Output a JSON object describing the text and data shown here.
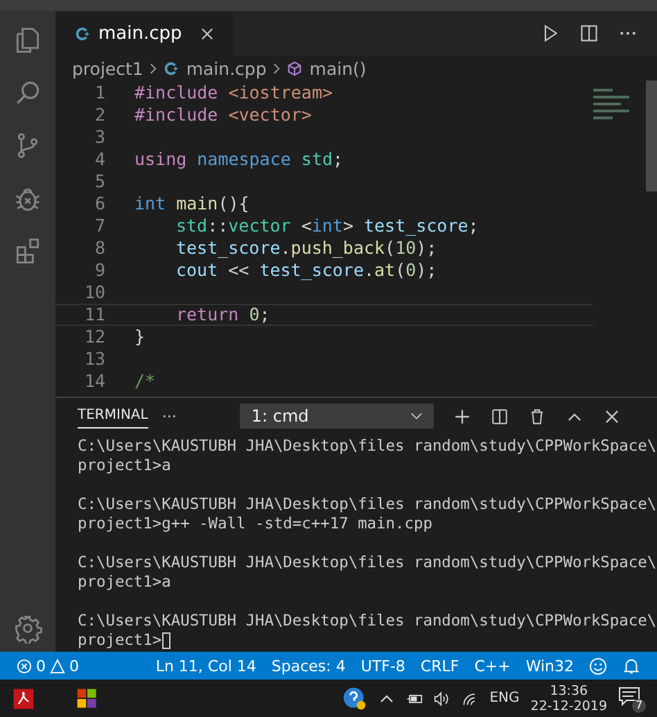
{
  "tabs": [
    {
      "label": "main.cpp",
      "selected": true
    }
  ],
  "breadcrumb": [
    "project1",
    "main.cpp",
    "main()"
  ],
  "code_lines": [
    {
      "number": "1",
      "tokens": [
        {
          "kind": "dir",
          "text": "#include "
        },
        {
          "kind": "str",
          "text": "<iostream>"
        }
      ]
    },
    {
      "number": "2",
      "tokens": [
        {
          "kind": "dir",
          "text": "#include "
        },
        {
          "kind": "str",
          "text": "<vector>"
        }
      ]
    },
    {
      "number": "3"
    },
    {
      "number": "4",
      "tokens": [
        {
          "kind": "kw",
          "text": "using "
        },
        {
          "kind": "type",
          "text": "namespace "
        },
        {
          "kind": "ns",
          "text": "std"
        },
        {
          "kind": "plain",
          "text": ";"
        }
      ]
    },
    {
      "number": "5"
    },
    {
      "number": "6",
      "tokens": [
        {
          "kind": "type",
          "text": "int "
        },
        {
          "kind": "fn",
          "text": "main"
        },
        {
          "kind": "plain",
          "text": "(){"
        }
      ]
    },
    {
      "number": "7",
      "indented": true,
      "tokens": [
        {
          "kind": "ns",
          "text": "std"
        },
        {
          "kind": "plain",
          "text": "::"
        },
        {
          "kind": "ns",
          "text": "vector"
        },
        {
          "kind": "plain",
          "text": " <"
        },
        {
          "kind": "type",
          "text": "int"
        },
        {
          "kind": "plain",
          "text": "> "
        },
        {
          "kind": "var",
          "text": "test_score"
        },
        {
          "kind": "plain",
          "text": ";"
        }
      ]
    },
    {
      "number": "8",
      "indented": true,
      "tokens": [
        {
          "kind": "var",
          "text": "test_score"
        },
        {
          "kind": "plain",
          "text": "."
        },
        {
          "kind": "fn",
          "text": "push_back"
        },
        {
          "kind": "plain",
          "text": "("
        },
        {
          "kind": "num",
          "text": "10"
        },
        {
          "kind": "plain",
          "text": ");"
        }
      ]
    },
    {
      "number": "9",
      "indented": true,
      "tokens": [
        {
          "kind": "var",
          "text": "cout"
        },
        {
          "kind": "plain",
          "text": " << "
        },
        {
          "kind": "var",
          "text": "test_score"
        },
        {
          "kind": "plain",
          "text": "."
        },
        {
          "kind": "fn",
          "text": "at"
        },
        {
          "kind": "plain",
          "text": "("
        },
        {
          "kind": "num",
          "text": "0"
        },
        {
          "kind": "plain",
          "text": ");"
        }
      ]
    },
    {
      "number": "10"
    },
    {
      "number": "11",
      "indented": true,
      "tokens": [
        {
          "kind": "kw",
          "text": "return "
        },
        {
          "kind": "num",
          "text": "0"
        },
        {
          "kind": "plain",
          "text": ";"
        }
      ],
      "current": true
    },
    {
      "number": "12",
      "tokens": [
        {
          "kind": "plain",
          "text": "}"
        }
      ]
    },
    {
      "number": "13"
    },
    {
      "number": "14",
      "tokens": [
        {
          "kind": "comment",
          "text": "/*"
        }
      ]
    }
  ],
  "panel": {
    "tab": "TERMINAL",
    "more": "···",
    "terminal_select": "1: cmd",
    "entries": [
      {
        "path": "C:\\Users\\KAUSTUBH JHA\\Desktop\\files random\\study\\CPPWorkSpace\\",
        "prompt": "project1>a"
      },
      {
        "path": "C:\\Users\\KAUSTUBH JHA\\Desktop\\files random\\study\\CPPWorkSpace\\",
        "prompt": "project1>g++ -Wall -std=c++17 main.cpp"
      },
      {
        "path": "C:\\Users\\KAUSTUBH JHA\\Desktop\\files random\\study\\CPPWorkSpace\\",
        "prompt": "project1>a"
      },
      {
        "path": "C:\\Users\\KAUSTUBH JHA\\Desktop\\files random\\study\\CPPWorkSpace\\",
        "prompt": "project1>"
      }
    ]
  },
  "status_bar": {
    "errors": "0",
    "warnings": "0",
    "items": [
      "Ln 11, Col 14",
      "Spaces: 4",
      "UTF-8",
      "CRLF",
      "C++",
      "Win32"
    ]
  },
  "taskbar": {
    "language": "ENG",
    "time": "13:36",
    "date": "22-12-2019",
    "notifications": "7"
  }
}
